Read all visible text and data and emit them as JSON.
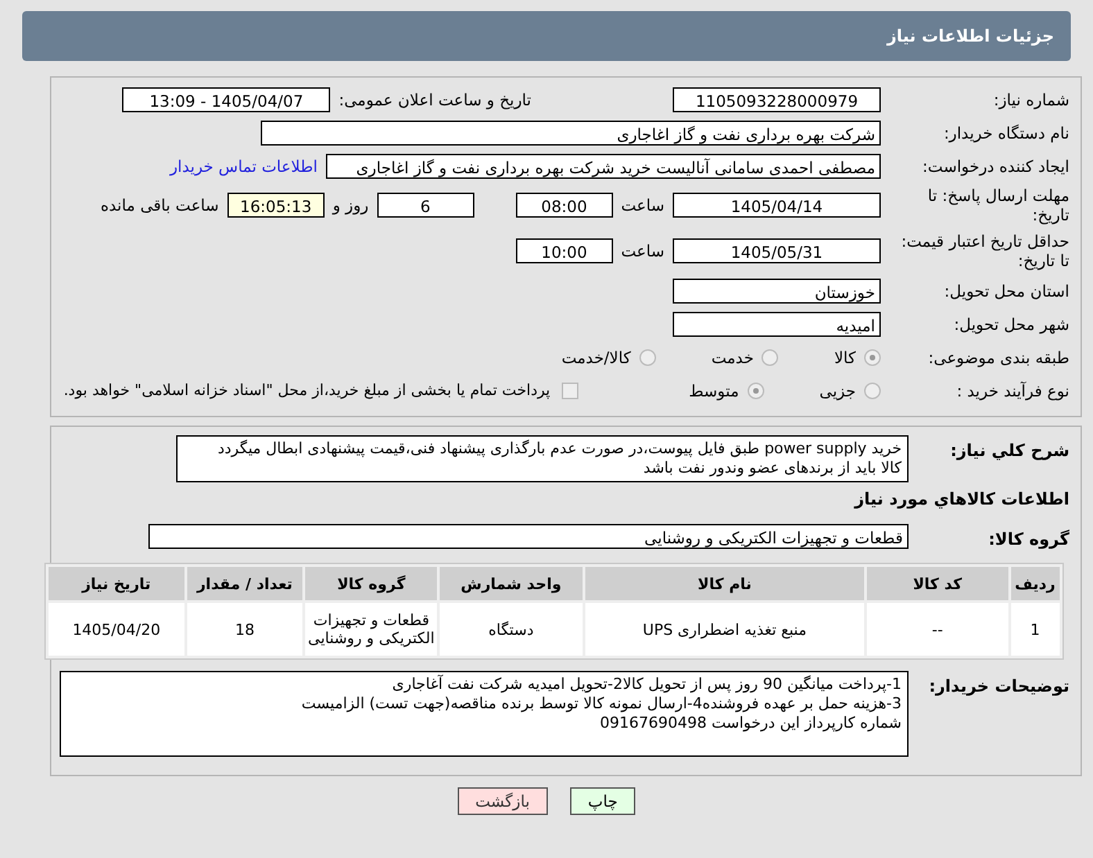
{
  "header": {
    "title": "جزئیات اطلاعات نیاز"
  },
  "need_number": {
    "label": "شماره نیاز:",
    "value": "1105093228000979"
  },
  "announce": {
    "label": "تاریخ و ساعت اعلان عمومی:",
    "value": "1405/04/07 - 13:09"
  },
  "buyer_org": {
    "label": "نام دستگاه خریدار:",
    "value": "شرکت بهره برداری نفت و گاز اغاجاری"
  },
  "creator": {
    "label": "ایجاد کننده درخواست:",
    "value": "مصطفی احمدی سامانی آنالیست خرید شرکت بهره برداری نفت و گاز اغاجاری",
    "link": "اطلاعات تماس خریدار"
  },
  "deadline": {
    "label": "مهلت ارسال پاسخ: تا تاریخ:",
    "date": "1405/04/14",
    "time_label": "ساعت",
    "time": "08:00",
    "days": "6",
    "days_label": "روز و",
    "remaining": "16:05:13",
    "remaining_label": "ساعت باقی مانده"
  },
  "validity": {
    "label": "حداقل تاریخ اعتبار قیمت: تا تاریخ:",
    "date": "1405/05/31",
    "time_label": "ساعت",
    "time": "10:00"
  },
  "province": {
    "label": "استان محل تحویل:",
    "value": "خوزستان"
  },
  "city": {
    "label": "شهر محل تحویل:",
    "value": "امیدیه"
  },
  "category": {
    "label": "طبقه بندی موضوعی:",
    "options": [
      {
        "label": "کالا",
        "selected": true
      },
      {
        "label": "خدمت",
        "selected": false
      },
      {
        "label": "کالا/خدمت",
        "selected": false
      }
    ]
  },
  "process": {
    "label": "نوع فرآیند خرید :",
    "options": [
      {
        "label": "جزیی",
        "selected": false
      },
      {
        "label": "متوسط",
        "selected": true
      }
    ],
    "payment": {
      "label": "پرداخت تمام یا بخشی از مبلغ خرید،از محل \"اسناد خزانه اسلامی\" خواهد بود.",
      "checked": false
    }
  },
  "description": {
    "label": "شرح کلي نياز:",
    "lines": [
      "خرید power supply طبق فایل پیوست،در صورت عدم بارگذاری پیشنهاد فنی،قیمت پیشنهادی ابطال میگردد",
      "کالا باید از برندهای عضو وندور نفت باشد"
    ]
  },
  "goods_heading": "اطلاعات کالاهاي مورد نياز",
  "goods_group": {
    "label": "گروه کالا:",
    "value": "قطعات و تجهیزات الکتریکی و روشنایی"
  },
  "table": {
    "columns": [
      "ردیف",
      "کد کالا",
      "نام کالا",
      "واحد شمارش",
      "گروه کالا",
      "تعداد / مقدار",
      "تاریخ نیاز"
    ],
    "rows": [
      [
        "1",
        "--",
        "منبع تغذیه اضطراری UPS",
        "دستگاه",
        "قطعات و تجهیزات الکتریکی و روشنایی",
        "18",
        "1405/04/20"
      ]
    ]
  },
  "buyer_notes": {
    "label": "توضیحات خریدار:",
    "lines": [
      "1-پرداخت میانگین 90 روز پس از تحویل کالا2-تحویل امیدیه شرکت نفت آغاجاری",
      "3-هزینه حمل بر عهده فروشنده4-ارسال نمونه کالا توسط برنده مناقصه(جهت تست) الزامیست",
      "شماره کارپرداز این درخواست 09167690498"
    ]
  },
  "buttons": [
    {
      "label": "چاپ",
      "kind": "print"
    },
    {
      "label": "بازگشت",
      "kind": "back"
    }
  ]
}
